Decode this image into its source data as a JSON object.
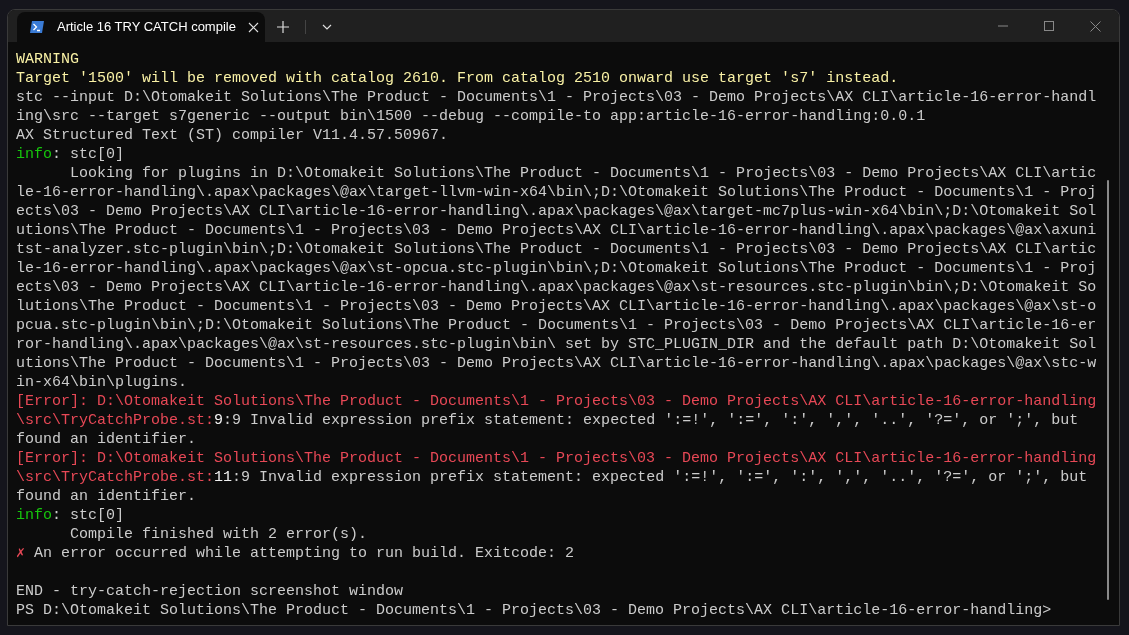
{
  "window": {
    "tab": {
      "title": "Article 16 TRY CATCH compile",
      "selected": true
    }
  },
  "lines": [
    {
      "kind": "text",
      "segments": [
        {
          "kind": "warning",
          "text": "WARNING"
        }
      ]
    },
    {
      "kind": "text",
      "segments": [
        {
          "kind": "warning",
          "text": "Target '1500' will be removed with catalog 2610. From catalog 2510 onward use target 's7' instead."
        }
      ]
    },
    {
      "kind": "text",
      "segments": [
        {
          "kind": "normal",
          "text": "stc --input D:\\Otomakeit Solutions\\The Product - Documents\\1 - Projects\\03 - Demo Projects\\AX CLI\\article-16-error-handling\\src --target s7generic --output bin\\1500 --debug --compile-to app:article-16-error-handling:0.0.1"
        }
      ]
    },
    {
      "kind": "text",
      "segments": [
        {
          "kind": "normal",
          "text": "AX Structured Text (ST) compiler V11.4.57.50967."
        }
      ]
    },
    {
      "kind": "text",
      "segments": [
        {
          "kind": "info",
          "text": "info"
        },
        {
          "kind": "normal",
          "text": ": stc[0]"
        }
      ]
    },
    {
      "kind": "text",
      "segments": [
        {
          "kind": "normal",
          "text": "      Looking for plugins in D:\\Otomakeit Solutions\\The Product - Documents\\1 - Projects\\03 - Demo Projects\\AX CLI\\article-16-error-handling\\.apax\\packages\\@ax\\target-llvm-win-x64\\bin\\;D:\\Otomakeit Solutions\\The Product - Documents\\1 - Projects\\03 - Demo Projects\\AX CLI\\article-16-error-handling\\.apax\\packages\\@ax\\target-mc7plus-win-x64\\bin\\;D:\\Otomakeit Solutions\\The Product - Documents\\1 - Projects\\03 - Demo Projects\\AX CLI\\article-16-error-handling\\.apax\\packages\\@ax\\axunitst-analyzer.stc-plugin\\bin\\;D:\\Otomakeit Solutions\\The Product - Documents\\1 - Projects\\03 - Demo Projects\\AX CLI\\article-16-error-handling\\.apax\\packages\\@ax\\st-opcua.stc-plugin\\bin\\;D:\\Otomakeit Solutions\\The Product - Documents\\1 - Projects\\03 - Demo Projects\\AX CLI\\article-16-error-handling\\.apax\\packages\\@ax\\st-resources.stc-plugin\\bin\\;D:\\Otomakeit Solutions\\The Product - Documents\\1 - Projects\\03 - Demo Projects\\AX CLI\\article-16-error-handling\\.apax\\packages\\@ax\\st-opcua.stc-plugin\\bin\\;D:\\Otomakeit Solutions\\The Product - Documents\\1 - Projects\\03 - Demo Projects\\AX CLI\\article-16-error-handling\\.apax\\packages\\@ax\\st-resources.stc-plugin\\bin\\ set by STC_PLUGIN_DIR and the default path D:\\Otomakeit Solutions\\The Product - Documents\\1 - Projects\\03 - Demo Projects\\AX CLI\\article-16-error-handling\\.apax\\packages\\@ax\\stc-win-x64\\bin\\plugins."
        }
      ]
    },
    {
      "kind": "text",
      "segments": [
        {
          "kind": "error",
          "text": "[Error]: D:\\Otomakeit Solutions\\The Product - Documents\\1 - Projects\\03 - Demo Projects\\AX CLI\\article-16-error-handling\\src\\TryCatchProbe.st:"
        },
        {
          "kind": "bright",
          "text": "9"
        },
        {
          "kind": "normal",
          "text": ":9 Invalid expression prefix statement: expected ':=!', ':=', ':', ',', '..', '?=', or ';', but found an identifier."
        }
      ]
    },
    {
      "kind": "text",
      "segments": [
        {
          "kind": "error",
          "text": "[Error]: D:\\Otomakeit Solutions\\The Product - Documents\\1 - Projects\\03 - Demo Projects\\AX CLI\\article-16-error-handling\\src\\TryCatchProbe.st:"
        },
        {
          "kind": "bright",
          "text": "11"
        },
        {
          "kind": "normal",
          "text": ":9 Invalid expression prefix statement: expected ':=!', ':=', ':', ',', '..', '?=', or ';', but found an identifier."
        }
      ]
    },
    {
      "kind": "text",
      "segments": [
        {
          "kind": "info",
          "text": "info"
        },
        {
          "kind": "normal",
          "text": ": stc[0]"
        }
      ]
    },
    {
      "kind": "text",
      "segments": [
        {
          "kind": "normal",
          "text": "      Compile finished with 2 error(s)."
        }
      ]
    },
    {
      "kind": "text",
      "segments": [
        {
          "kind": "error",
          "text": "✗"
        },
        {
          "kind": "normal",
          "text": " An error occurred while attempting to run build. Exitcode: 2"
        }
      ]
    },
    {
      "kind": "blank"
    },
    {
      "kind": "text",
      "segments": [
        {
          "kind": "normal",
          "text": "END - try-catch-rejection screenshot window"
        }
      ]
    },
    {
      "kind": "text",
      "segments": [
        {
          "kind": "normal",
          "text": "PS D:\\Otomakeit Solutions\\The Product - Documents\\1 - Projects\\03 - Demo Projects\\AX CLI\\article-16-error-handling>"
        }
      ]
    }
  ]
}
